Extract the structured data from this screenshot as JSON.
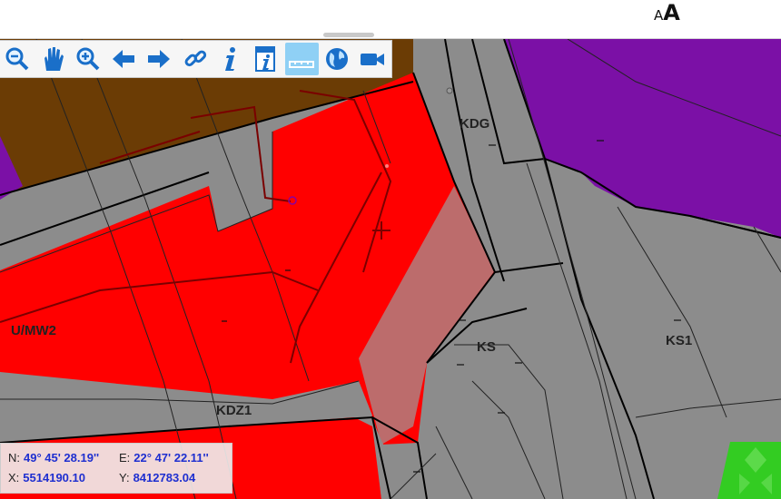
{
  "header": {
    "font_toggle_small": "A",
    "font_toggle_large": "A"
  },
  "toolbar": {
    "tools": [
      {
        "icon": "zoom-out-icon"
      },
      {
        "icon": "pan-hand-icon"
      },
      {
        "icon": "zoom-in-icon"
      },
      {
        "icon": "back-arrow-icon"
      },
      {
        "icon": "forward-arrow-icon"
      },
      {
        "icon": "link-icon"
      },
      {
        "icon": "info-icon"
      },
      {
        "icon": "info-document-icon"
      },
      {
        "icon": "measure-ruler-icon",
        "active": true
      },
      {
        "icon": "globe-icon"
      },
      {
        "icon": "video-camera-icon"
      }
    ]
  },
  "map": {
    "zones": [
      {
        "code": "KDG"
      },
      {
        "code": "KS"
      },
      {
        "code": "KS1"
      },
      {
        "code": "U/MW2"
      },
      {
        "code": "KDZ1"
      }
    ],
    "colors": {
      "residential_red": "#ff0000",
      "brown": "#6b3c05",
      "purple": "#7b10a6",
      "road_gray": "#8c8c8c",
      "green": "#33cc22",
      "highlight": "#b87272"
    }
  },
  "coordinates": {
    "n_label": "N:",
    "n_value": "49° 45' 28.19''",
    "e_label": "E:",
    "e_value": "22° 47' 22.11''",
    "x_label": "X:",
    "x_value": "5514190.10",
    "y_label": "Y:",
    "y_value": "8412783.04"
  }
}
